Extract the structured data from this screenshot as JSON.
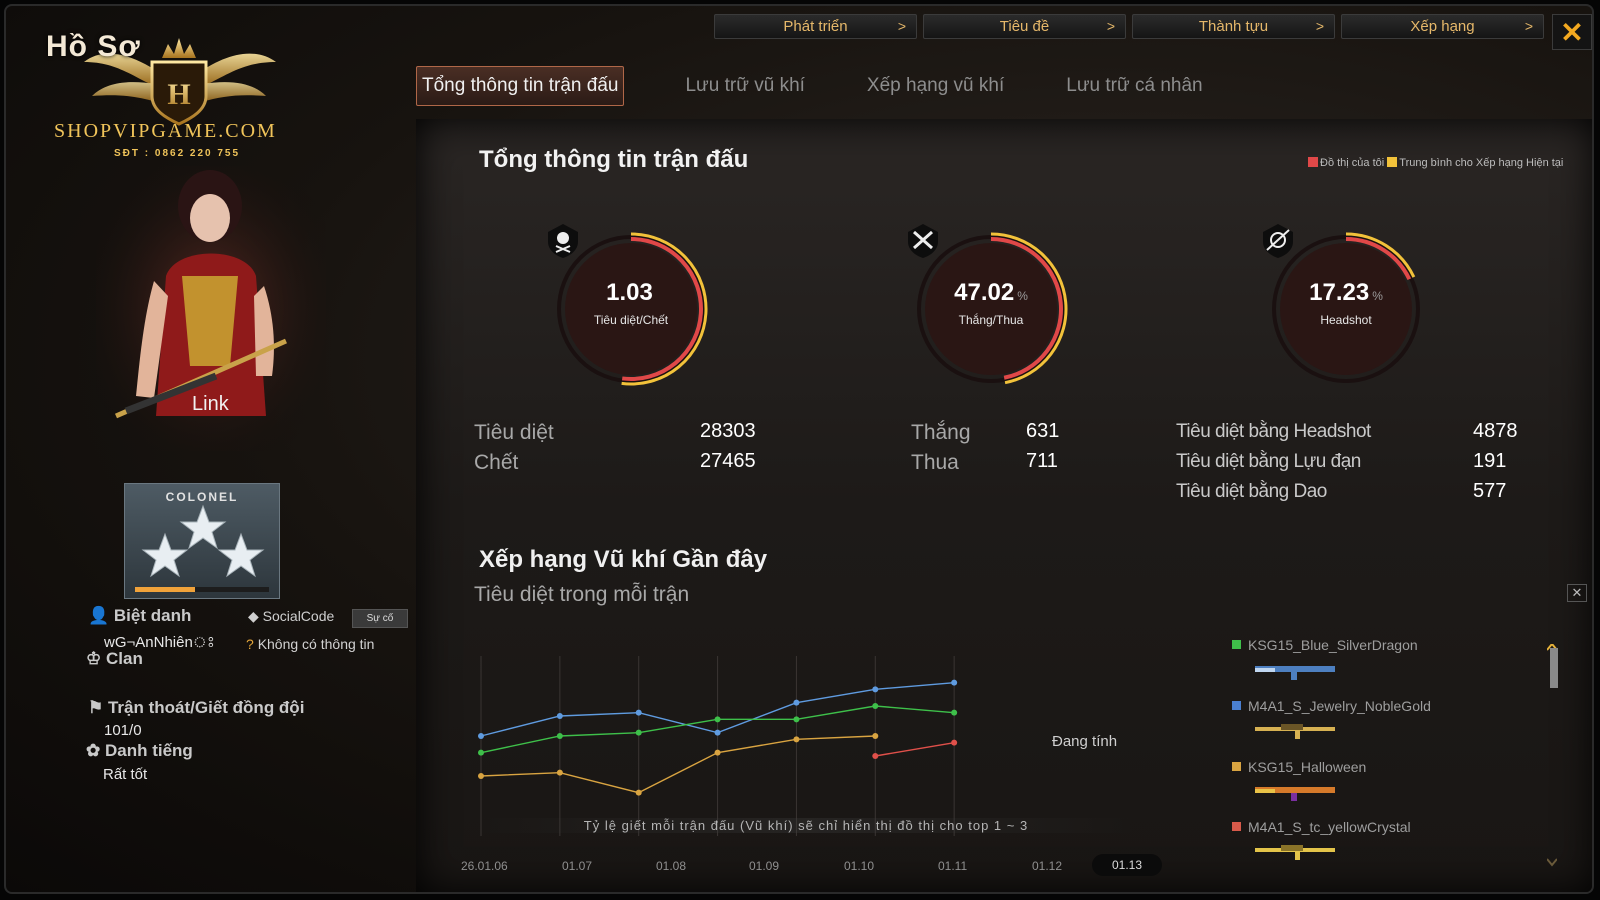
{
  "topnav": [
    {
      "label": "Phát triển",
      "chevron": ">"
    },
    {
      "label": "Tiêu đề",
      "chevron": ">"
    },
    {
      "label": "Thành tựu",
      "chevron": ">"
    },
    {
      "label": "Xếp hạng",
      "chevron": ">"
    }
  ],
  "close_glyph": "✕",
  "tabs": [
    "Tổng thông tin trận đấu",
    "Lưu trữ vũ khí",
    "Xếp hạng vũ khí",
    "Lưu trữ cá nhân"
  ],
  "profile": {
    "title": "Hồ Sơ",
    "logo_text": "SHOPVIPGAME.COM",
    "phone": "SĐT : 0862 220 755",
    "char_name": "Link",
    "rank": "COLONEL",
    "rank_progress": 0.45,
    "nickname_label": "Biệt danh",
    "nickname": "wG¬AnNhiênঃ",
    "socialcode_label": "SocialCode",
    "socialcode_btn": "Sự cố",
    "no_info": "Không có thông tin",
    "clan_label": "Clan",
    "desert_label": "Trận thoát/Giết đồng đội",
    "desert_value": "101/0",
    "reputation_label": "Danh tiếng",
    "reputation_value": "Rất tốt"
  },
  "summary": {
    "title": "Tổng thông tin trận đấu",
    "legend_mine": "Đồ thị của tôi",
    "legend_avg": "Trung bình cho Xếp hạng Hiện tại",
    "legend_mine_color": "#e04848",
    "legend_avg_color": "#f2c23a",
    "gauges": [
      {
        "value": "1.03",
        "pct": "",
        "label": "Tiêu diệt/Chết",
        "icon": "skull-icon",
        "fill": 0.52
      },
      {
        "value": "47.02",
        "pct": "%",
        "label": "Thắng/Thua",
        "icon": "crossed-swords-icon",
        "fill": 0.47
      },
      {
        "value": "17.23",
        "pct": "%",
        "label": "Headshot",
        "icon": "rifle-icon",
        "fill": 0.18
      }
    ],
    "kd": {
      "kills_label": "Tiêu diệt",
      "kills": "28303",
      "deaths_label": "Chết",
      "deaths": "27465"
    },
    "wl": {
      "wins_label": "Thắng",
      "wins": "631",
      "losses_label": "Thua",
      "losses": "711"
    },
    "hs": {
      "headshot_label": "Tiêu diệt bằng Headshot",
      "headshot": "4878",
      "grenade_label": "Tiêu diệt bằng Lựu đạn",
      "grenade": "191",
      "knife_label": "Tiêu diệt bằng Dao",
      "knife": "577"
    }
  },
  "recent": {
    "title": "Xếp hạng Vũ khí Gần đây",
    "subtitle": "Tiêu diệt trong mỗi trận",
    "calculating": "Đang tính",
    "note": "Tỷ lệ giết mỗi trận đấu (Vũ khí) sẽ chỉ hiển thị đồ thị cho top 1 ~ 3",
    "weapons": [
      {
        "name": "KSG15_Blue_SilverDragon",
        "color": "#3fbf4a"
      },
      {
        "name": "M4A1_S_Jewelry_NobleGold",
        "color": "#4a7fd0"
      },
      {
        "name": "KSG15_Halloween",
        "color": "#d9a441"
      },
      {
        "name": "M4A1_S_tc_yellowCrystal",
        "color": "#d85a4a"
      }
    ]
  },
  "chart_data": {
    "type": "line",
    "categories": [
      "26.01.06",
      "01.07",
      "01.08",
      "01.09",
      "01.10",
      "01.11",
      "01.12",
      "01.13"
    ],
    "active_category": "01.13",
    "series": [
      {
        "name": "KSG15_Blue_SilverDragon",
        "color": "#5f9be0",
        "values": [
          1.4,
          2.0,
          2.1,
          1.5,
          2.4,
          2.8,
          3.0,
          null
        ]
      },
      {
        "name": "M4A1_S_Jewelry_NobleGold",
        "color": "#3ec04a",
        "values": [
          0.9,
          1.4,
          1.5,
          1.9,
          1.9,
          2.3,
          2.1,
          null
        ]
      },
      {
        "name": "KSG15_Halloween",
        "color": "#d9a441",
        "values": [
          0.2,
          0.3,
          -0.3,
          0.9,
          1.3,
          1.4,
          null,
          null
        ]
      },
      {
        "name": "M4A1_S_tc_yellowCrystal",
        "color": "#e0504a",
        "values": [
          null,
          null,
          null,
          null,
          null,
          0.8,
          1.2,
          null
        ]
      }
    ],
    "ylim": [
      -1,
      3.5
    ],
    "grid": true
  }
}
